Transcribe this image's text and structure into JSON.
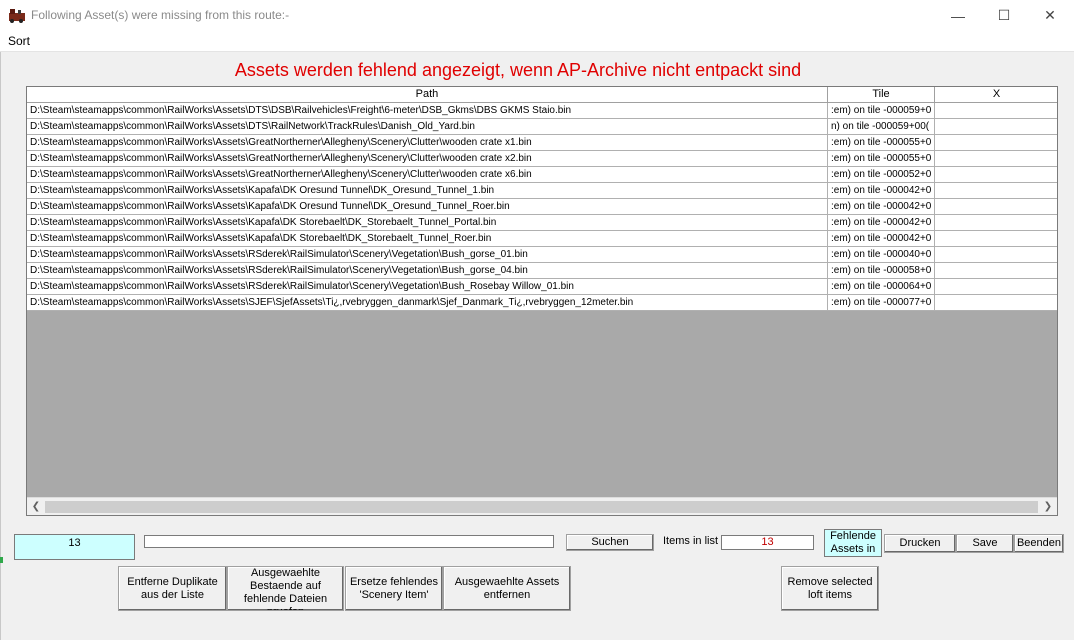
{
  "window": {
    "title": "Following Asset(s) were missing from this route:-",
    "controls": {
      "minimize": "—",
      "maximize": "☐",
      "close": "✕"
    }
  },
  "menu": {
    "sort": "Sort"
  },
  "banner": "Assets werden fehlend angezeigt, wenn AP-Archive nicht entpackt sind",
  "grid": {
    "columns": [
      "Path",
      "Tile",
      "X"
    ],
    "rows": [
      {
        "path": "D:\\Steam\\steamapps\\common\\RailWorks\\Assets\\DTS\\DSB\\Railvehicles\\Freight\\6-meter\\DSB_Gkms\\DBS GKMS Staio.bin",
        "tile": ":em) on tile -000059+0"
      },
      {
        "path": "D:\\Steam\\steamapps\\common\\RailWorks\\Assets\\DTS\\RailNetwork\\TrackRules\\Danish_Old_Yard.bin",
        "tile": "n) on tile -000059+00("
      },
      {
        "path": "D:\\Steam\\steamapps\\common\\RailWorks\\Assets\\GreatNortherner\\Allegheny\\Scenery\\Clutter\\wooden crate x1.bin",
        "tile": ":em) on tile -000055+0"
      },
      {
        "path": "D:\\Steam\\steamapps\\common\\RailWorks\\Assets\\GreatNortherner\\Allegheny\\Scenery\\Clutter\\wooden crate x2.bin",
        "tile": ":em) on tile -000055+0"
      },
      {
        "path": "D:\\Steam\\steamapps\\common\\RailWorks\\Assets\\GreatNortherner\\Allegheny\\Scenery\\Clutter\\wooden crate x6.bin",
        "tile": ":em) on tile -000052+0"
      },
      {
        "path": "D:\\Steam\\steamapps\\common\\RailWorks\\Assets\\Kapafa\\DK Oresund Tunnel\\DK_Oresund_Tunnel_1.bin",
        "tile": ":em) on tile -000042+0"
      },
      {
        "path": "D:\\Steam\\steamapps\\common\\RailWorks\\Assets\\Kapafa\\DK Oresund Tunnel\\DK_Oresund_Tunnel_Roer.bin",
        "tile": ":em) on tile -000042+0"
      },
      {
        "path": "D:\\Steam\\steamapps\\common\\RailWorks\\Assets\\Kapafa\\DK Storebaelt\\DK_Storebaelt_Tunnel_Portal.bin",
        "tile": ":em) on tile -000042+0"
      },
      {
        "path": "D:\\Steam\\steamapps\\common\\RailWorks\\Assets\\Kapafa\\DK Storebaelt\\DK_Storebaelt_Tunnel_Roer.bin",
        "tile": ":em) on tile -000042+0"
      },
      {
        "path": "D:\\Steam\\steamapps\\common\\RailWorks\\Assets\\RSderek\\RailSimulator\\Scenery\\Vegetation\\Bush_gorse_01.bin",
        "tile": ":em) on tile -000040+0"
      },
      {
        "path": "D:\\Steam\\steamapps\\common\\RailWorks\\Assets\\RSderek\\RailSimulator\\Scenery\\Vegetation\\Bush_gorse_04.bin",
        "tile": ":em) on tile -000058+0"
      },
      {
        "path": "D:\\Steam\\steamapps\\common\\RailWorks\\Assets\\RSderek\\RailSimulator\\Scenery\\Vegetation\\Bush_Rosebay Willow_01.bin",
        "tile": ":em) on tile -000064+0"
      },
      {
        "path": "D:\\Steam\\steamapps\\common\\RailWorks\\Assets\\SJEF\\SjefAssets\\Ti¿,rvebryggen_danmark\\Sjef_Danmark_Ti¿,rvebryggen_12meter.bin",
        "tile": ":em) on tile -000077+0"
      }
    ]
  },
  "bottom": {
    "count_value": "13",
    "search_value": "",
    "search_button": "Suchen",
    "items_label": "Items in list",
    "items_value": "13",
    "fehlende_label": "Fehlende Assets in",
    "drucken": "Drucken",
    "save": "Save",
    "beenden": "Beenden",
    "remove_duplicates": "Entferne Duplikate aus der Liste",
    "check_existing": "Ausgewaehlte Bestaende auf fehlende Dateien pruefen",
    "replace_scenery": "Ersetze fehlendes 'Scenery Item'",
    "remove_selected_assets": "Ausgewaehlte Assets entfernen",
    "remove_loft": "Remove selected loft items"
  },
  "colors": {
    "banner": "#e00000",
    "count_bg": "#cdffff",
    "items_value": "#c00000"
  },
  "icons": {
    "app": "locomotive-icon",
    "scroll_left": "chevron-left-icon",
    "scroll_right": "chevron-right-icon"
  }
}
